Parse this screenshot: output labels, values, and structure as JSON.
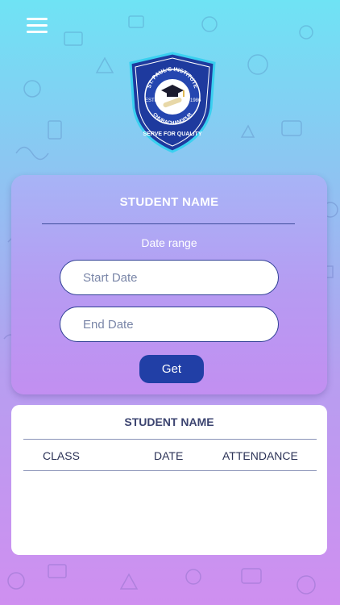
{
  "header": {
    "menu_icon": "hamburger-menu-icon"
  },
  "logo": {
    "institute_name": "ST. PAUL'S INSTITUTE",
    "location": "CHURACHANDPUR",
    "motto": "SERVE FOR QUALITY",
    "estd_label": "ESTD.",
    "estd_year": "1986"
  },
  "form": {
    "title": "STUDENT NAME",
    "date_range_label": "Date range",
    "start_placeholder": "Start Date",
    "end_placeholder": "End Date",
    "get_label": "Get"
  },
  "table": {
    "title": "STUDENT NAME",
    "columns": [
      "CLASS",
      "DATE",
      "ATTENDANCE"
    ]
  },
  "colors": {
    "bg_top": "#6fe3f4",
    "bg_bottom": "#cf8ff0",
    "accent": "#213fa6",
    "shield": "#1e3a9e"
  }
}
